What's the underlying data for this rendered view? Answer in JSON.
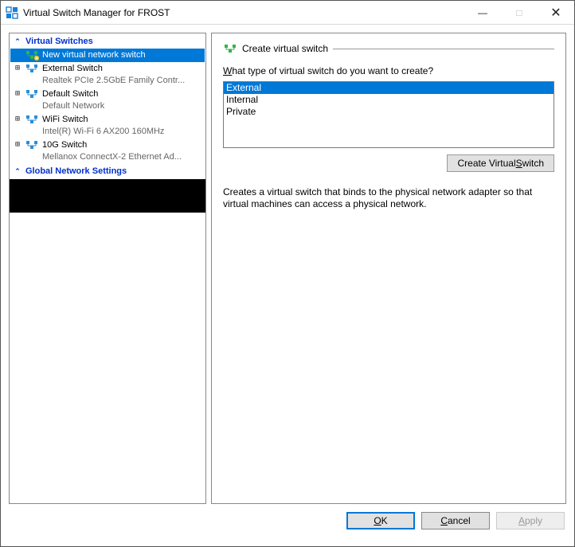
{
  "title": "Virtual Switch Manager for FROST",
  "window_controls": {
    "minimize": "—",
    "maximize": "□",
    "close": "✕"
  },
  "tree": {
    "header_switches": "Virtual Switches",
    "new_switch": "New virtual network switch",
    "items": [
      {
        "label": "External Switch",
        "sub": "Realtek PCIe 2.5GbE Family Contr..."
      },
      {
        "label": "Default Switch",
        "sub": "Default Network"
      },
      {
        "label": "WiFi Switch",
        "sub": "Intel(R) Wi-Fi 6 AX200 160MHz"
      },
      {
        "label": "10G Switch",
        "sub": "Mellanox ConnectX-2 Ethernet Ad..."
      }
    ],
    "header_global": "Global Network Settings"
  },
  "right": {
    "section_title": "Create virtual switch",
    "prompt_pre": "W",
    "prompt_rest": "hat type of virtual switch do you want to create?",
    "options": [
      "External",
      "Internal",
      "Private"
    ],
    "create_btn_pre": "Create Virtual ",
    "create_btn_ul": "S",
    "create_btn_post": "witch",
    "description": "Creates a virtual switch that binds to the physical network adapter so that virtual machines can access a physical network."
  },
  "footer": {
    "ok_ul": "O",
    "ok_post": "K",
    "cancel_ul": "C",
    "cancel_post": "ancel",
    "apply_ul": "A",
    "apply_post": "pply"
  }
}
